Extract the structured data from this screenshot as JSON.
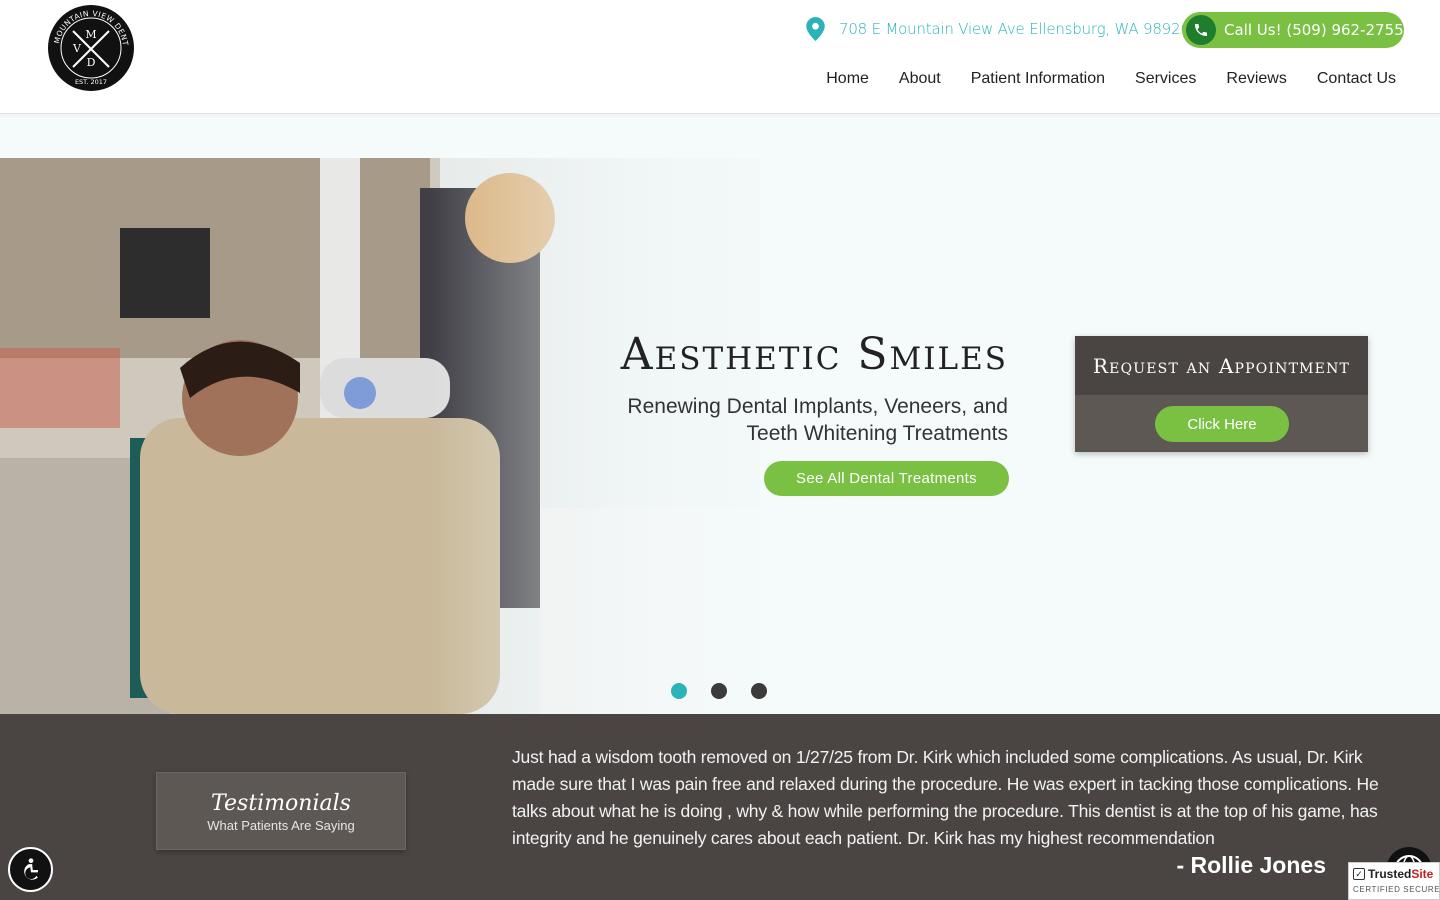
{
  "brand": {
    "logo_text_arc": "MOUNTAIN VIEW DENTAL",
    "logo_letters": [
      "M",
      "V",
      "D"
    ],
    "logo_est": "EST. 2017"
  },
  "header": {
    "address": "708 E Mountain View Ave Ellensburg, WA 98926",
    "call_label": "Call Us! (509) 962-2755",
    "nav": [
      "Home",
      "About",
      "Patient Information",
      "Services",
      "Reviews",
      "Contact Us"
    ]
  },
  "hero": {
    "title": "Aesthetic Smiles",
    "subtitle": "Renewing Dental Implants, Veneers, and Teeth Whitening Treatments",
    "button": "See All Dental Treatments",
    "slides_total": 3,
    "active_slide": 1,
    "appointment": {
      "heading": "Request an Appointment",
      "button": "Click Here"
    }
  },
  "testimonials": {
    "title": "Testimonials",
    "subtitle": "What Patients Are Saying",
    "quote": "Just had a wisdom tooth removed on 1/27/25 from Dr. Kirk which included some complications. As usual, Dr. Kirk made sure that I was pain free and relaxed during the procedure. He was expert in tacking those complications. He talks about what he is doing , why & how while performing the procedure. This dentist is at the top of his game, has integrity and he genuinely cares about each patient. Dr. Kirk has my highest recommendation",
    "author": "- Rollie Jones"
  },
  "badge": {
    "brand_a": "Trusted",
    "brand_b": "Site",
    "tagline": "CERTIFIED SECURE"
  },
  "colors": {
    "accent_green": "#7ac143",
    "accent_teal": "#2bb3b8",
    "dark_band": "#4a4542",
    "panel": "#5e5855"
  },
  "icons": [
    "location-pin-icon",
    "phone-icon",
    "accessibility-icon",
    "globe-icon",
    "check-icon"
  ]
}
